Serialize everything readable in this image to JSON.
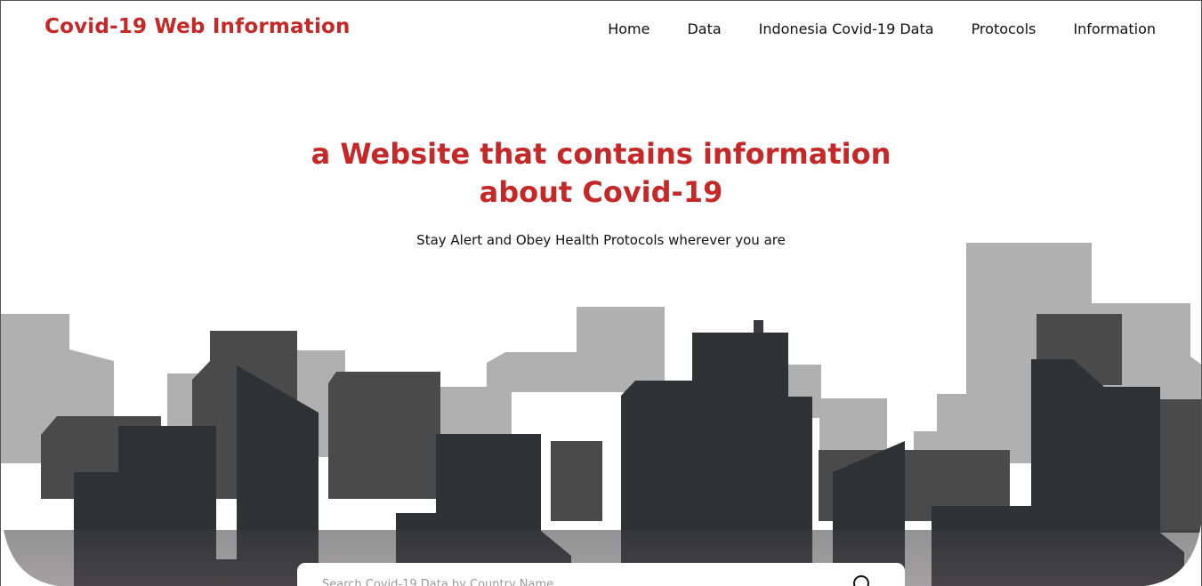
{
  "brand": {
    "name": "Covid-19 Web Information"
  },
  "nav": {
    "items": [
      {
        "label": "Home"
      },
      {
        "label": "Data"
      },
      {
        "label": "Indonesia Covid-19 Data"
      },
      {
        "label": "Protocols"
      },
      {
        "label": "Information"
      }
    ]
  },
  "hero": {
    "title_line1": "a Website that contains information",
    "title_line2": "about Covid-19",
    "subtitle": "Stay Alert and Obey Health Protocols wherever you are"
  },
  "search": {
    "placeholder": "Search Covid-19 Data by Country Name",
    "icon": "search-icon"
  },
  "colors": {
    "accent": "#c62828",
    "building_light": "#b0b0b0",
    "building_mid": "#4a4a4a",
    "building_dark": "#2f3133"
  }
}
